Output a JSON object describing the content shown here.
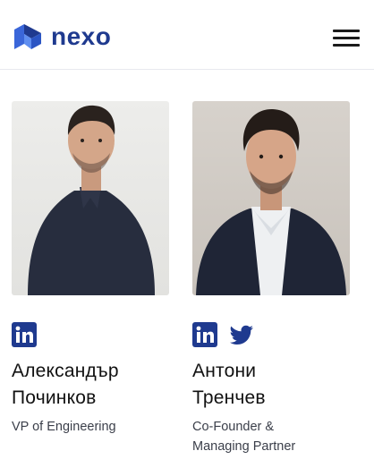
{
  "header": {
    "brand": "nexo",
    "brand_color": "#1f3a8f",
    "logo_icon": "nexo-logo-icon",
    "menu_icon": "hamburger-menu-icon"
  },
  "team": [
    {
      "name_line1": "Александър",
      "name_line2": "Починков",
      "role_line1": "VP of Engineering",
      "role_line2": "",
      "socials": [
        "linkedin-icon"
      ]
    },
    {
      "name_line1": "Антони",
      "name_line2": "Тренчев",
      "role_line1": "Co-Founder &",
      "role_line2": "Managing Partner",
      "socials": [
        "linkedin-icon",
        "twitter-icon"
      ]
    }
  ],
  "colors": {
    "linkedin": "#1f3a8f",
    "twitter": "#1f3a8f"
  }
}
